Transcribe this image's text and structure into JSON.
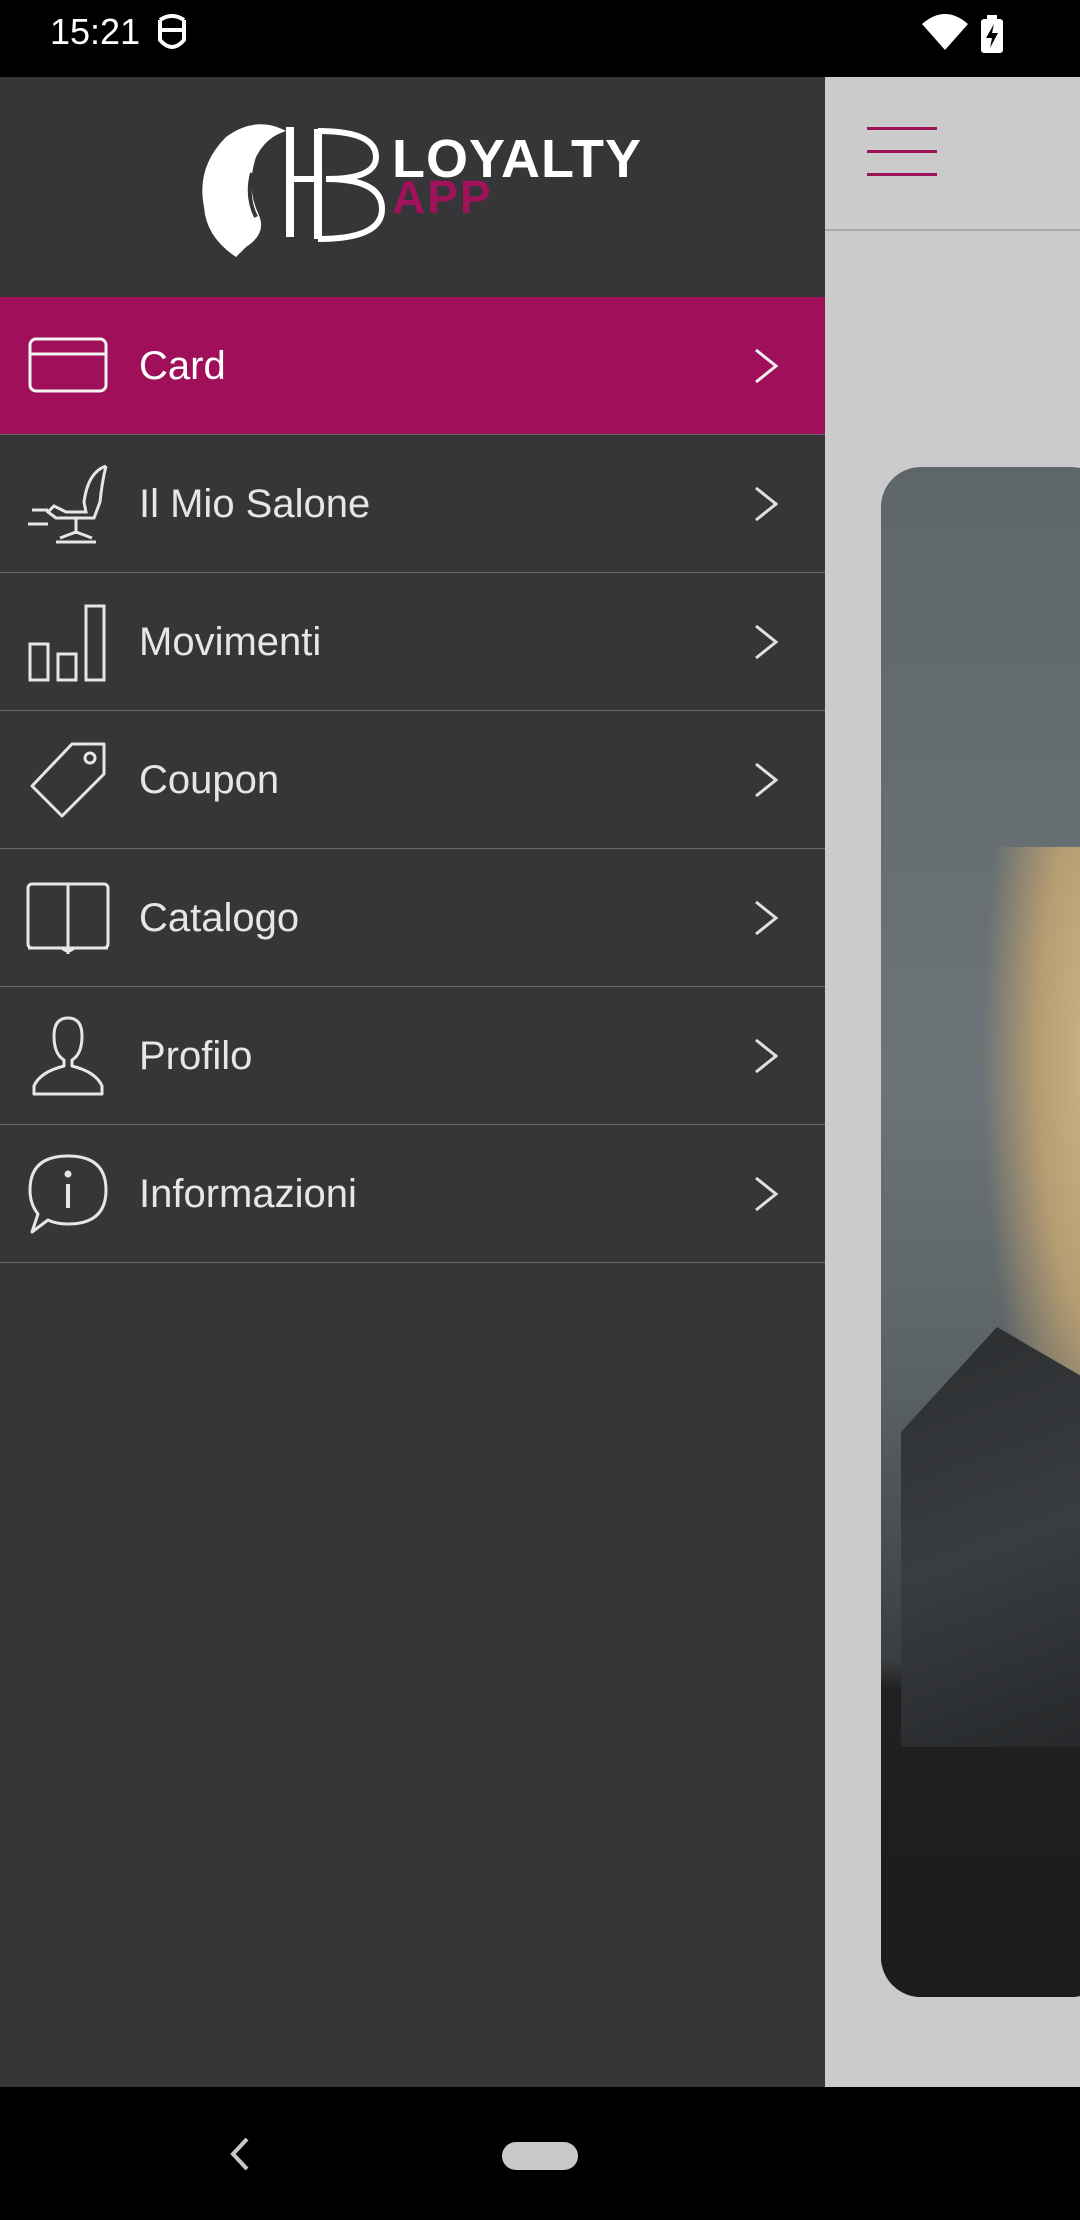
{
  "status_bar": {
    "time": "15:21",
    "icons": [
      "notification-icon",
      "wifi-icon",
      "battery-charging-icon"
    ]
  },
  "drawer": {
    "logo": {
      "line1": "LOYALTY",
      "line2": "APP",
      "accent_color": "#a0125b"
    },
    "items": [
      {
        "label": "Card",
        "icon": "card-icon",
        "active": true
      },
      {
        "label": "Il Mio Salone",
        "icon": "salon-chair-icon",
        "active": false
      },
      {
        "label": "Movimenti",
        "icon": "bar-chart-icon",
        "active": false
      },
      {
        "label": "Coupon",
        "icon": "tag-icon",
        "active": false
      },
      {
        "label": "Catalogo",
        "icon": "book-icon",
        "active": false
      },
      {
        "label": "Profilo",
        "icon": "user-icon",
        "active": false
      },
      {
        "label": "Informazioni",
        "icon": "info-bubble-icon",
        "active": false
      }
    ],
    "active_color": "#a0105a",
    "background": "#363537"
  },
  "content": {
    "menu_icon": "hamburger-menu-icon",
    "menu_color": "#9b1458"
  },
  "nav_bar": {
    "back_icon": "back-icon",
    "home_icon": "home-pill-icon"
  }
}
